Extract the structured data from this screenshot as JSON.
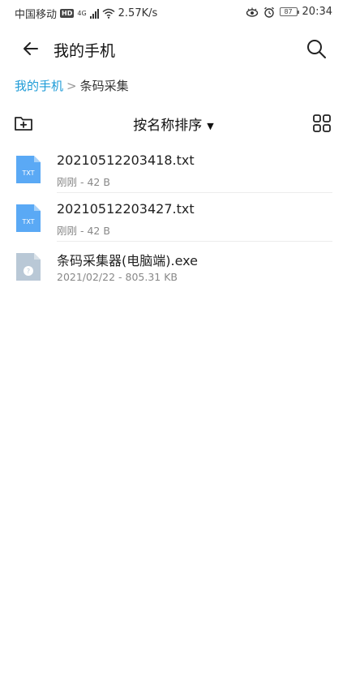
{
  "status_bar": {
    "carrier": "中国移动",
    "hd": "HD",
    "network": "4G",
    "speed": "2.57K/s",
    "battery": "87",
    "time": "20:34"
  },
  "app_bar": {
    "title": "我的手机",
    "back_icon": "arrow-left-icon",
    "search_icon": "search-icon"
  },
  "breadcrumb": {
    "root": "我的手机",
    "separator": ">",
    "current": "条码采集"
  },
  "toolbar": {
    "sort_label": "按名称排序",
    "new_folder_icon": "new-folder-icon",
    "grid_icon": "grid-view-icon"
  },
  "files": [
    {
      "name": "20210512203418.txt",
      "meta": "刚刚 - 42 B",
      "type": "TXT",
      "color": "#5aa9f5"
    },
    {
      "name": "20210512203427.txt",
      "meta": "刚刚 - 42 B",
      "type": "TXT",
      "color": "#5aa9f5"
    },
    {
      "name": "条码采集器(电脑端).exe",
      "meta": "2021/02/22 - 805.31 KB",
      "type": "?",
      "color": "#b9c8d6"
    }
  ]
}
